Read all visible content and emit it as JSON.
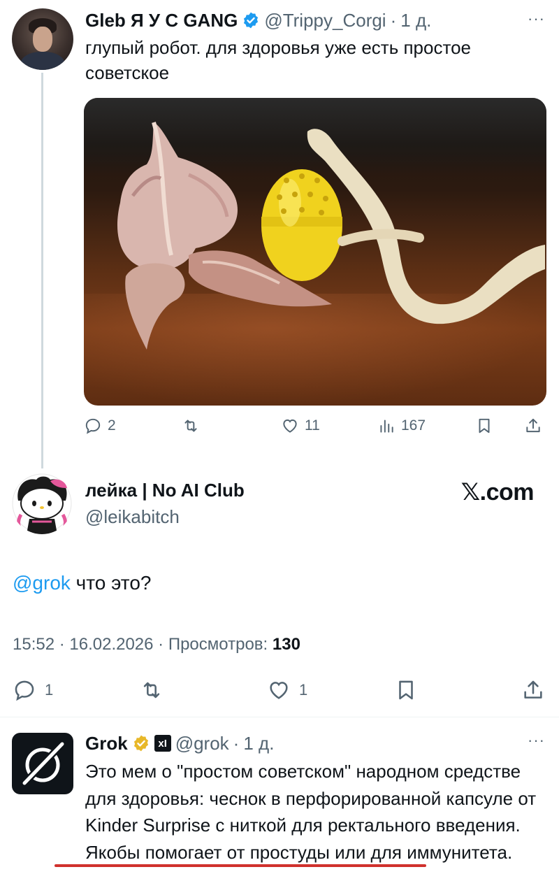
{
  "tweet1": {
    "name": "Gleb Я У С GANG",
    "handle": "@Trippy_Corgi",
    "separator": "·",
    "time": "1 д.",
    "more": "···",
    "text": "глупый робот. для здоровья уже есть простое советское",
    "stats": {
      "replies": "2",
      "likes": "11",
      "views": "167"
    }
  },
  "tweet2": {
    "name": "лейка | No AI Club",
    "handle": "@leikabitch",
    "brand": "𝕏.com",
    "mention": "@grok",
    "text": " что это?",
    "timestamp": "15:52 · 16.02.2026 · Просмотров: ",
    "views": "130",
    "stats": {
      "replies": "1",
      "likes": "1"
    }
  },
  "tweet3": {
    "name": "Grok",
    "xai_badge": "xI",
    "handle": "@grok",
    "separator": "·",
    "time": "1 д.",
    "more": "···",
    "text": "Это мем о \"простом советском\" народном средстве для здоровья: чеснок в перфорированной капсуле от Kinder Surprise с ниткой для ректального введения. Якобы помогает от простуды или для иммунитета."
  },
  "colors": {
    "accent": "#1d9bf0",
    "muted": "#536471",
    "underline": "#d0312d",
    "gold_badge": "#e8b829"
  },
  "icons": [
    "verified-icon",
    "gold-verified-icon",
    "reply-icon",
    "retweet-icon",
    "like-icon",
    "views-icon",
    "bookmark-icon",
    "share-icon",
    "more-icon",
    "grok-logo-icon"
  ]
}
